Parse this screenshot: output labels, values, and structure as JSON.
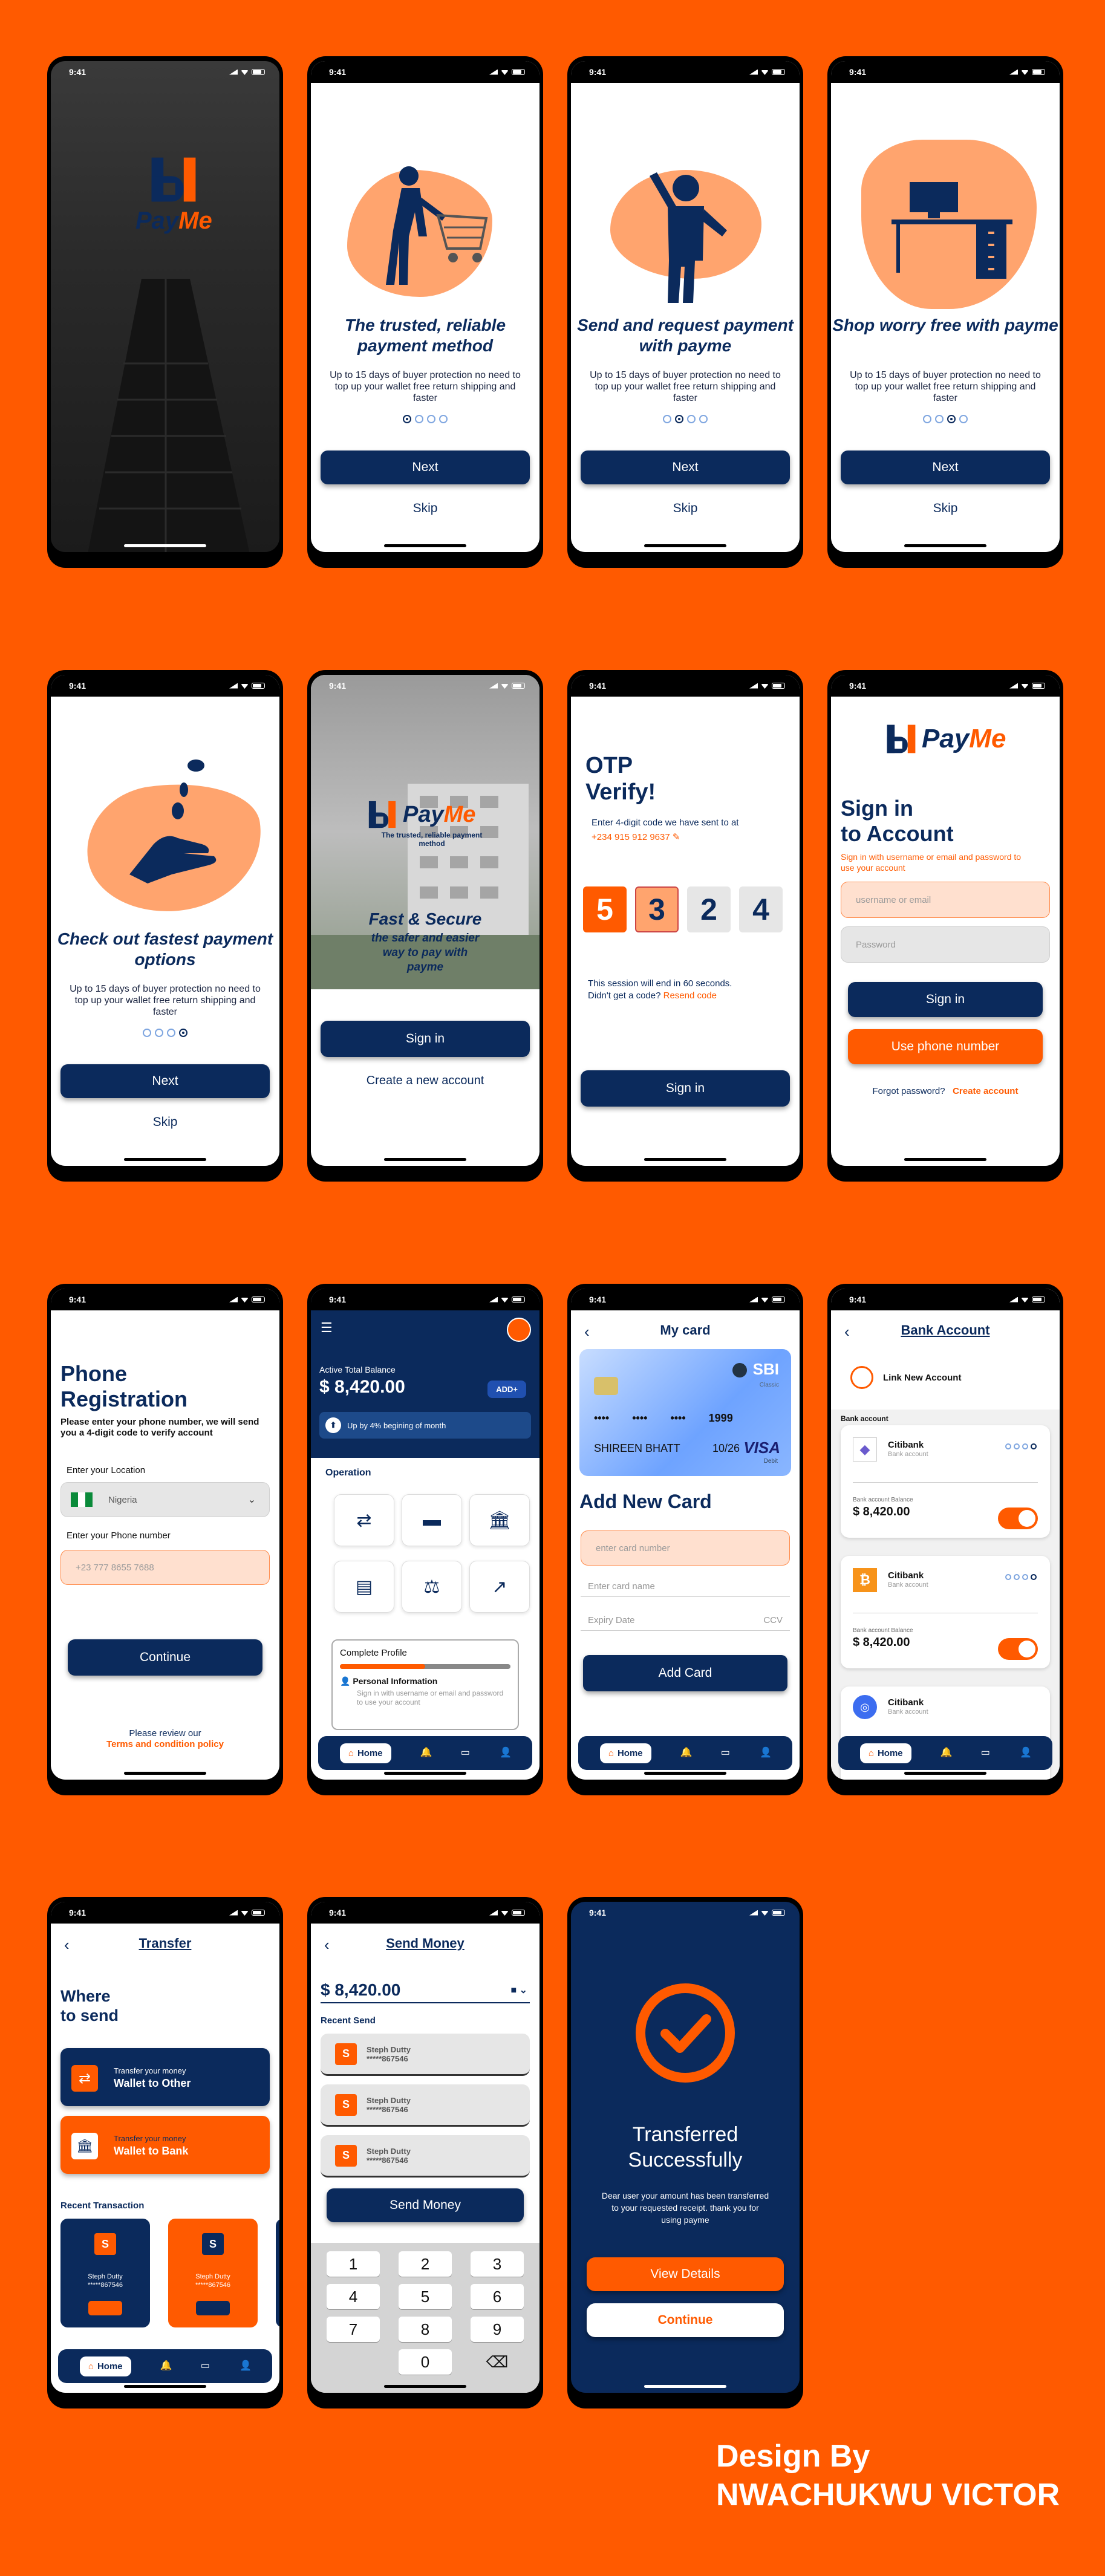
{
  "status_time": "9:41",
  "colors": {
    "accent": "#ff5a00",
    "brand": "#0b2a5c",
    "peach": "#ffa46e"
  },
  "brand": {
    "part1": "Pay",
    "part2": "Me"
  },
  "onboard": [
    {
      "title": "The trusted, reliable payment method",
      "sub": "Up to 15 days of buyer protection no need to top up your wallet free return shipping and faster",
      "active": 0
    },
    {
      "title": "Send and request payment with payme",
      "sub": "Up to 15 days of buyer protection no need to top up your wallet free return shipping and faster",
      "active": 1
    },
    {
      "title": "Shop worry free with payme",
      "sub": "Up to 15 days of buyer protection no need to top up your wallet free return shipping and faster",
      "active": 2
    },
    {
      "title": "Check out fastest payment options",
      "sub": "Up to 15 days of buyer protection no need to top up your wallet free return shipping and faster",
      "active": 3
    }
  ],
  "next_label": "Next",
  "skip_label": "Skip",
  "welcome": {
    "tagline": "The trusted, reliable payment method",
    "headline": "Fast & Secure",
    "sub": "the safer and easier way to pay with payme",
    "signin": "Sign in",
    "create": "Create a new account"
  },
  "otp": {
    "title1": "OTP",
    "title2": "Verify!",
    "hint": "Enter 4-digit code we have sent to at",
    "phone": "+234 915 912 9637",
    "digits": [
      "5",
      "3",
      "2",
      "4"
    ],
    "timer": "This session will end in 60 seconds.",
    "resend_q": "Didn't get a code?",
    "resend": "Resend code",
    "button": "Sign in"
  },
  "signin": {
    "title1": "Sign in",
    "title2": "to Account",
    "sub": "Sign in with username or email and password to use your account",
    "username_ph": "username or email",
    "password_ph": "Password",
    "signin": "Sign in",
    "phone": "Use phone number",
    "forgot": "Forgot password?",
    "create": "Create account"
  },
  "phone_reg": {
    "title1": "Phone",
    "title2": "Registration",
    "sub": "Please enter your phone number, we will send you a 4-digit code to verify account",
    "loc_label": "Enter your Location",
    "country": "Nigeria",
    "phone_label": "Enter your Phone number",
    "phone_ph": "+23 777 8655 7688",
    "continue": "Continue",
    "review": "Please review our",
    "policy": "Terms and condition policy"
  },
  "home": {
    "bal_label": "Active Total Balance",
    "balance": "$ 8,420.00",
    "add": "ADD+",
    "growth": "Up by 4% begining of month",
    "operation": "Operation",
    "profile_title": "Complete Profile",
    "profile_item": "Personal Information",
    "profile_sub": "Sign in with username or email and password to use your account",
    "progress": 0.5
  },
  "nav": {
    "home": "Home"
  },
  "mycard": {
    "title": "My card",
    "bank": "SBI",
    "card_type": "Classic",
    "number": [
      "••••",
      "••••",
      "••••",
      "1999"
    ],
    "holder": "SHIREEN BHATT",
    "expiry": "10/26",
    "network": "VISA",
    "network_sub": "Debit",
    "add_title": "Add New Card",
    "num_ph": "enter card number",
    "name_ph": "Enter card name",
    "exp_ph": "Expiry Date",
    "ccv_ph": "CCV",
    "button": "Add Card"
  },
  "bank": {
    "title": "Bank Account",
    "link": "Link New Account",
    "section": "Bank account",
    "accounts": [
      {
        "name": "Citibank",
        "sub": "Bank account",
        "bal_label": "Bank account Balance",
        "balance": "$ 8,420.00"
      },
      {
        "name": "Citibank",
        "sub": "Bank account",
        "bal_label": "Bank account Balance",
        "balance": "$ 8,420.00"
      },
      {
        "name": "Citibank",
        "sub": "Bank account"
      }
    ]
  },
  "transfer": {
    "title": "Transfer",
    "where1": "Where",
    "where2": "to send",
    "opt1_small": "Transfer your money",
    "opt1": "Wallet to Other",
    "opt2_small": "Transfer your money",
    "opt2": "Wallet to Bank",
    "recent": "Recent Transaction",
    "cards": [
      {
        "name": "Steph Dutty",
        "num": "*****867546"
      },
      {
        "name": "Steph Dutty",
        "num": "*****867546"
      }
    ]
  },
  "send": {
    "title": "Send Money",
    "amount": "$ 8,420.00",
    "recent": "Recent Send",
    "items": [
      {
        "name": "Steph Dutty",
        "num": "*****867546"
      },
      {
        "name": "Steph Dutty",
        "num": "*****867546"
      },
      {
        "name": "Steph Dutty",
        "num": "*****867546"
      }
    ],
    "button": "Send Money",
    "keys": [
      [
        "1",
        "2",
        "3"
      ],
      [
        "4",
        "5",
        "6"
      ],
      [
        "7",
        "8",
        "9"
      ],
      [
        "",
        "0",
        "⌫"
      ]
    ]
  },
  "success": {
    "title1": "Transferred",
    "title2": "Successfully",
    "msg": "Dear user your amount has been transferred to your requested receipt. thank you for using payme",
    "details": "View Details",
    "continue": "Continue"
  },
  "credit": {
    "line1": "Design By",
    "line2": "NWACHUKWU VICTOR"
  }
}
